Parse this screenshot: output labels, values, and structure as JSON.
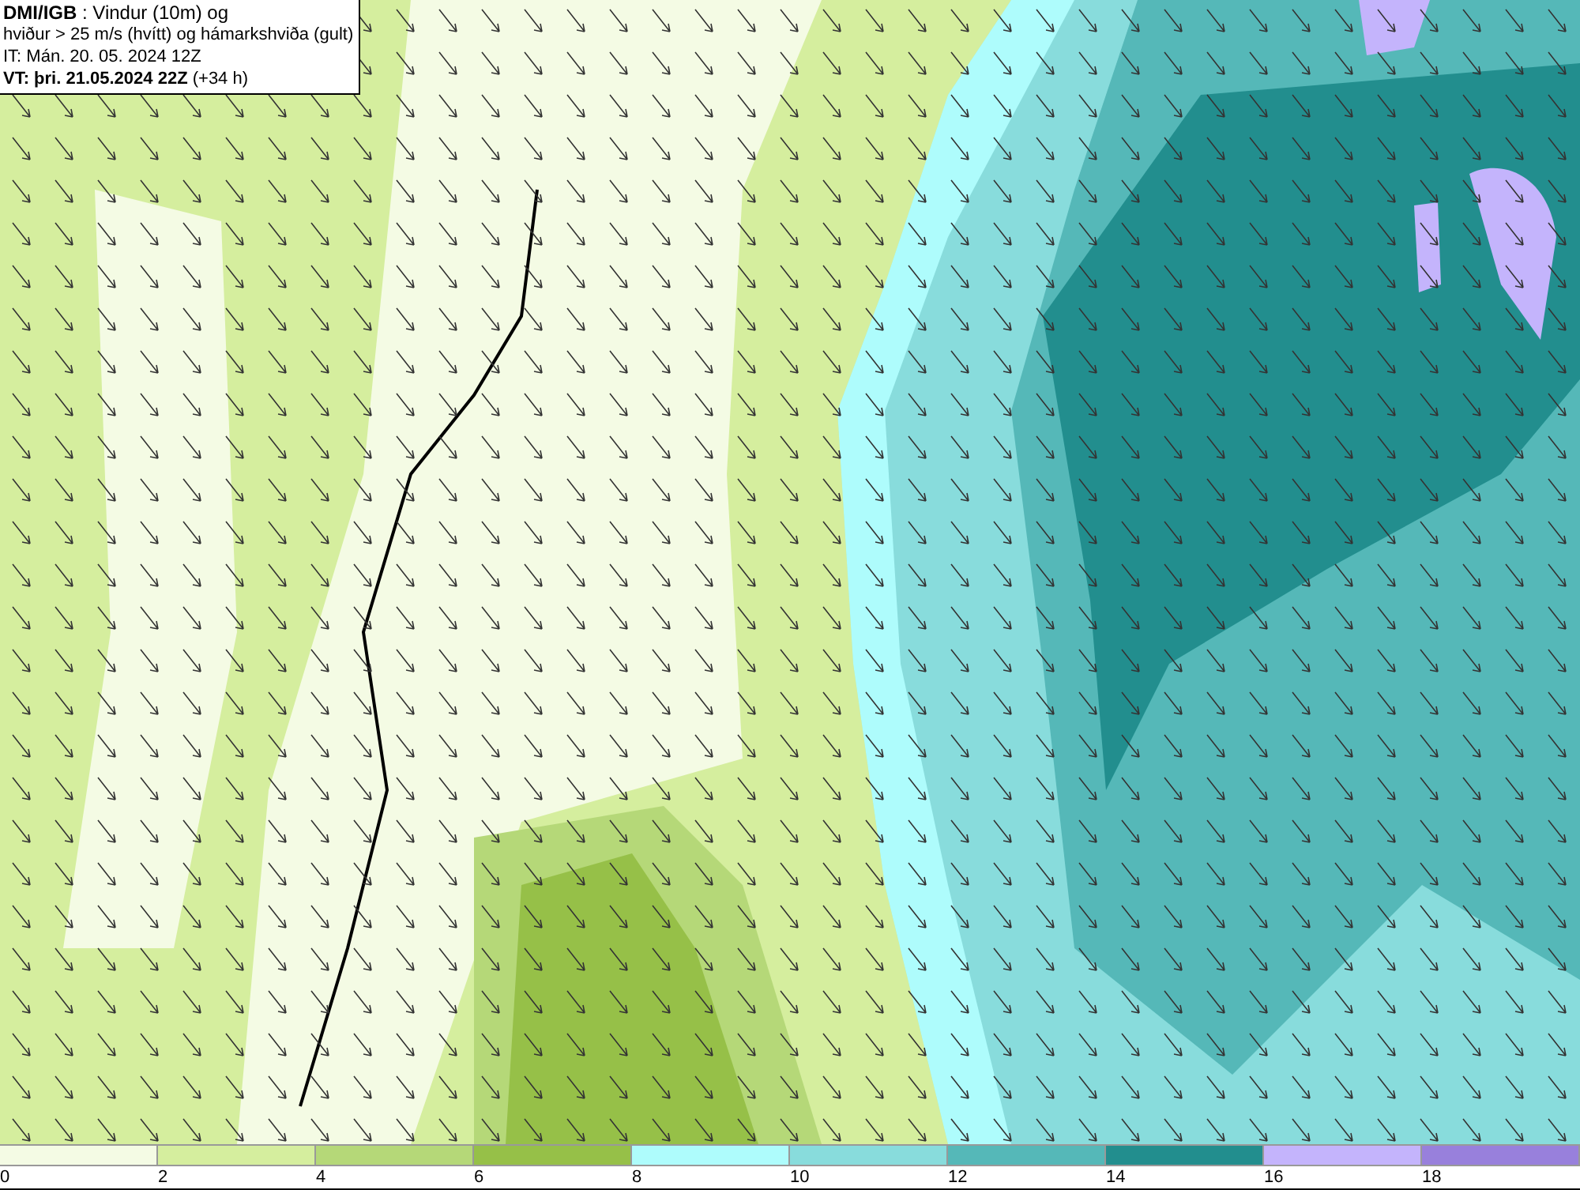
{
  "title_box": {
    "lines": [
      "**DMI/IGB** : Vindur (10m) og",
      "hviður > 25 m/s (hvítt) og hámarkshviða (gult)",
      "IT: Mán. 20. 05. 2024 12Z",
      "**VT: þri. 21.05.2024 22Z** (+34 h)"
    ]
  },
  "legend": [
    {
      "label": "0",
      "color": "#f4fbe4"
    },
    {
      "label": "2",
      "color": "#d5ee9e"
    },
    {
      "label": "4",
      "color": "#b5d878"
    },
    {
      "label": "6",
      "color": "#96c048"
    },
    {
      "label": "8",
      "color": "#aefcfc"
    },
    {
      "label": "10",
      "color": "#88dcdc"
    },
    {
      "label": "12",
      "color": "#55b8b8"
    },
    {
      "label": "14",
      "color": "#228e8e"
    },
    {
      "label": "16",
      "color": "#c4b4fc"
    },
    {
      "label": "18",
      "color": "#9880dc"
    }
  ]
}
